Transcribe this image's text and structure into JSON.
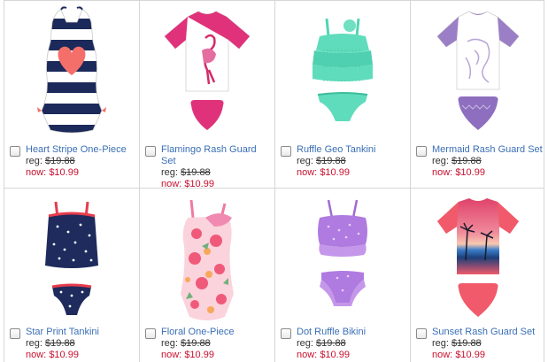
{
  "products": [
    {
      "name": "Heart Stripe One-Piece",
      "reg_label": "reg:",
      "reg_price": "$19.88",
      "now_label": "now:",
      "now_price": "$10.99"
    },
    {
      "name": "Flamingo Rash Guard Set",
      "reg_label": "reg:",
      "reg_price": "$19.88",
      "now_label": "now:",
      "now_price": "$10.99"
    },
    {
      "name": "Ruffle Geo Tankini",
      "reg_label": "reg:",
      "reg_price": "$19.88",
      "now_label": "now:",
      "now_price": "$10.99"
    },
    {
      "name": "Mermaid Rash Guard Set",
      "reg_label": "reg:",
      "reg_price": "$19.88",
      "now_label": "now:",
      "now_price": "$10.99"
    },
    {
      "name": "Star Print Tankini",
      "reg_label": "reg:",
      "reg_price": "$19.88",
      "now_label": "now:",
      "now_price": "$10.99"
    },
    {
      "name": "Floral One-Piece",
      "reg_label": "reg:",
      "reg_price": "$19.88",
      "now_label": "now:",
      "now_price": "$10.99"
    },
    {
      "name": "Dot Ruffle Bikini",
      "reg_label": "reg:",
      "reg_price": "$19.88",
      "now_label": "now:",
      "now_price": "$10.99"
    },
    {
      "name": "Sunset Rash Guard Set",
      "reg_label": "reg:",
      "reg_price": "$19.88",
      "now_label": "now:",
      "now_price": "$10.99"
    }
  ],
  "colors": {
    "link": "#3a6fb6",
    "sale": "#c8102e",
    "border": "#d6d6d6"
  }
}
